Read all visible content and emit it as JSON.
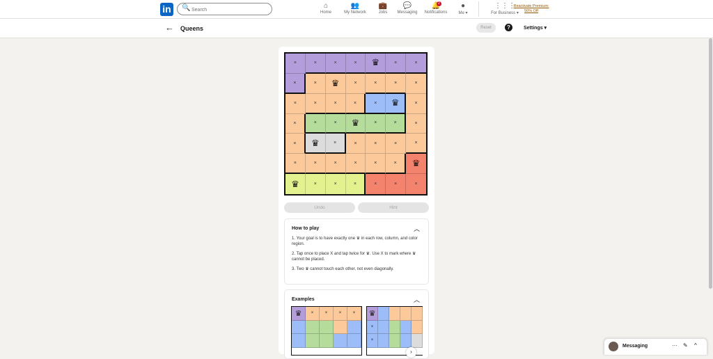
{
  "nav": {
    "logo": "in",
    "search_placeholder": "Search",
    "items": [
      {
        "label": "Home",
        "icon": "home-icon",
        "glyph": "⌂"
      },
      {
        "label": "My Network",
        "icon": "network-icon",
        "glyph": "👥"
      },
      {
        "label": "Jobs",
        "icon": "jobs-icon",
        "glyph": "💼"
      },
      {
        "label": "Messaging",
        "icon": "messaging-icon",
        "glyph": "💬"
      },
      {
        "label": "Notifications",
        "icon": "bell-icon",
        "glyph": "🔔",
        "badge": "2"
      },
      {
        "label": "Me ▾",
        "icon": "avatar",
        "glyph": "●"
      },
      {
        "label": "For Business ▾",
        "icon": "grid-icon",
        "glyph": "⋮⋮⋮"
      }
    ],
    "premium": "Reactivate Premium: 50% Off"
  },
  "subheader": {
    "back": "←",
    "title": "Queens",
    "reset": "Reset",
    "help": "?",
    "settings": "Settings ▾"
  },
  "board": {
    "colors": {
      "P": "#b39ddb",
      "O": "#fbc99a",
      "B": "#9cbdf7",
      "G": "#b5dc9a",
      "W": "#dcdcdc",
      "R": "#f4836d",
      "Y": "#e3f28e"
    },
    "regions": [
      "PPPPPPP",
      "POOOOOO",
      "OOOOBBO",
      "OGGGGGO",
      "OWWOOOO",
      "OOOOOOR",
      "YYYYRRR"
    ],
    "marks": [
      "xxxxQxx",
      "xxQxxxx",
      "xxxxxQx",
      "xxxQxxx",
      "xQxxxxx",
      "xxxxxxQ",
      "Qxxxxxx"
    ],
    "queen": "♛",
    "cross": "×"
  },
  "buttons": {
    "undo": "Undo",
    "hint": "Hint"
  },
  "howto": {
    "title": "How to play",
    "rules": [
      "1. Your goal is to have exactly one ♛ in each row, column, and color region.",
      "2. Tap once to place X and tap twice for ♛. Use X to mark where ♛ cannot be placed.",
      "3. Two ♛ cannot touch each other, not even diagonally."
    ]
  },
  "examples": {
    "title": "Examples",
    "ex1_regions": [
      "POOOO",
      "BGGOB",
      "BGGBB"
    ],
    "ex1_marks": [
      "Qxxxx",
      "     ",
      "     "
    ],
    "ex2_regions": [
      "PBOOO",
      "BBGBO",
      "BBGBW"
    ],
    "ex2_marks": [
      "Q    ",
      "x    ",
      "x    "
    ]
  },
  "messaging": {
    "label": "Messaging",
    "more": "···",
    "compose": "✎",
    "collapse": "^"
  }
}
